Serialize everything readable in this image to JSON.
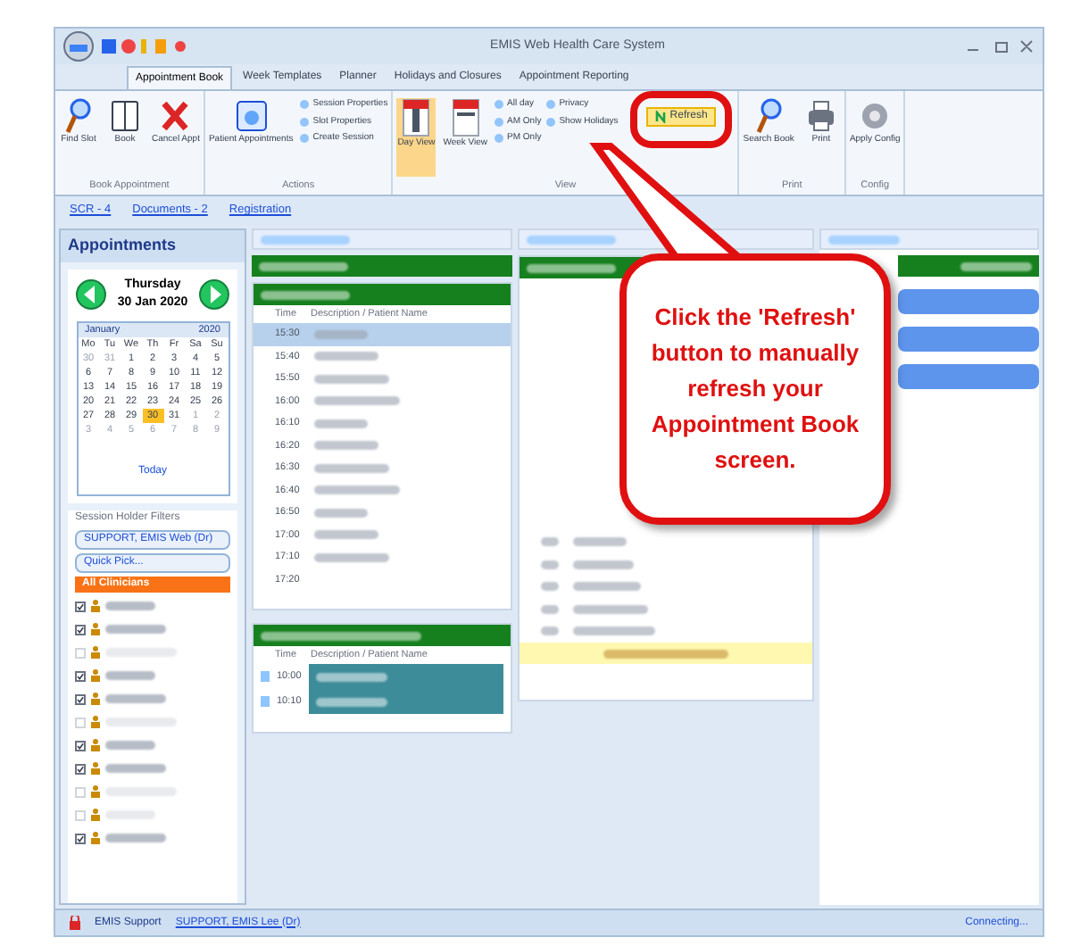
{
  "window": {
    "title": "EMIS Web Health Care System"
  },
  "tabs": [
    {
      "label": "Appointment Book",
      "selected": true
    },
    {
      "label": "Week Templates",
      "selected": false
    },
    {
      "label": "Planner",
      "selected": false
    },
    {
      "label": "Holidays and Closures",
      "selected": false
    },
    {
      "label": "Appointment Reporting",
      "selected": false
    }
  ],
  "ribbon_groups": [
    {
      "label": "Book Appointment",
      "buttons": [
        {
          "label": "Find Slot",
          "kind": "search"
        },
        {
          "label": "Book",
          "kind": "book"
        },
        {
          "label": "Cancel Appt",
          "kind": "cancel"
        }
      ]
    },
    {
      "label": "Actions",
      "buttons": [
        {
          "label": "Patient Appointments",
          "kind": "patient"
        }
      ],
      "small": [
        "Session Properties",
        "Slot Properties",
        "Create Session"
      ]
    },
    {
      "label": "View",
      "buttons": [
        {
          "label": "Day View",
          "kind": "day",
          "selected": true
        },
        {
          "label": "Week View",
          "kind": "week",
          "selected": false
        }
      ],
      "small": [
        "All day",
        "AM Only",
        "PM Only",
        "Privacy",
        "Show Holidays"
      ],
      "refresh": "Refresh"
    },
    {
      "label": "Print",
      "buttons": [
        {
          "label": "Search Book",
          "kind": "search"
        },
        {
          "label": "Print",
          "kind": "print"
        }
      ]
    },
    {
      "label": "Config",
      "buttons": [
        {
          "label": "Apply Config",
          "kind": "config"
        }
      ]
    }
  ],
  "links": [
    "SCR - 4",
    "Documents - 2",
    "Registration"
  ],
  "sidebar": {
    "title": "Appointments",
    "day": "Thursday",
    "date": "30 Jan 2020",
    "month": "January",
    "year": "2020",
    "weekdays": [
      "Mo",
      "Tu",
      "We",
      "Th",
      "Fr",
      "Sa",
      "Su"
    ],
    "days": [
      {
        "d": "30",
        "other": true,
        "selected": false
      },
      {
        "d": "31",
        "other": true,
        "selected": false
      },
      {
        "d": "1",
        "other": false,
        "selected": false
      },
      {
        "d": "2",
        "other": false,
        "selected": false
      },
      {
        "d": "3",
        "other": false,
        "selected": false
      },
      {
        "d": "4",
        "other": false,
        "selected": false
      },
      {
        "d": "5",
        "other": false,
        "selected": false
      },
      {
        "d": "6",
        "other": false,
        "selected": false
      },
      {
        "d": "7",
        "other": false,
        "selected": false
      },
      {
        "d": "8",
        "other": false,
        "selected": false
      },
      {
        "d": "9",
        "other": false,
        "selected": false
      },
      {
        "d": "10",
        "other": false,
        "selected": false
      },
      {
        "d": "11",
        "other": false,
        "selected": false
      },
      {
        "d": "12",
        "other": false,
        "selected": false
      },
      {
        "d": "13",
        "other": false,
        "selected": false
      },
      {
        "d": "14",
        "other": false,
        "selected": false
      },
      {
        "d": "15",
        "other": false,
        "selected": false
      },
      {
        "d": "16",
        "other": false,
        "selected": false
      },
      {
        "d": "17",
        "other": false,
        "selected": false
      },
      {
        "d": "18",
        "other": false,
        "selected": false
      },
      {
        "d": "19",
        "other": false,
        "selected": false
      },
      {
        "d": "20",
        "other": false,
        "selected": false
      },
      {
        "d": "21",
        "other": false,
        "selected": false
      },
      {
        "d": "22",
        "other": false,
        "selected": false
      },
      {
        "d": "23",
        "other": false,
        "selected": false
      },
      {
        "d": "24",
        "other": false,
        "selected": false
      },
      {
        "d": "25",
        "other": false,
        "selected": false
      },
      {
        "d": "26",
        "other": false,
        "selected": false
      },
      {
        "d": "27",
        "other": false,
        "selected": false
      },
      {
        "d": "28",
        "other": false,
        "selected": false
      },
      {
        "d": "29",
        "other": false,
        "selected": false
      },
      {
        "d": "30",
        "other": false,
        "selected": true
      },
      {
        "d": "31",
        "other": false,
        "selected": false
      },
      {
        "d": "1",
        "other": true,
        "selected": false
      },
      {
        "d": "2",
        "other": true,
        "selected": false
      },
      {
        "d": "3",
        "other": true,
        "selected": false
      },
      {
        "d": "4",
        "other": true,
        "selected": false
      },
      {
        "d": "5",
        "other": true,
        "selected": false
      },
      {
        "d": "6",
        "other": true,
        "selected": false
      },
      {
        "d": "7",
        "other": true,
        "selected": false
      },
      {
        "d": "8",
        "other": true,
        "selected": false
      },
      {
        "d": "9",
        "other": true,
        "selected": false
      }
    ],
    "today": "Today",
    "filters_title": "Session Holder Filters",
    "holder": "SUPPORT, EMIS Web (Dr)",
    "quick_pick": "Quick Pick...",
    "all_clinicians": "All Clinicians",
    "clinicians": [
      {
        "checked": true
      },
      {
        "checked": true
      },
      {
        "checked": false
      },
      {
        "checked": true
      },
      {
        "checked": true
      },
      {
        "checked": false
      },
      {
        "checked": true
      },
      {
        "checked": true
      },
      {
        "checked": false
      },
      {
        "checked": false
      },
      {
        "checked": true
      }
    ]
  },
  "column_1": {
    "headers": [
      "Time",
      "Description / Patient Name"
    ],
    "rows": [
      {
        "time": "15:30",
        "selected": true
      },
      {
        "time": "15:40",
        "selected": false
      },
      {
        "time": "15:50",
        "selected": false
      },
      {
        "time": "16:00",
        "selected": false
      },
      {
        "time": "16:10",
        "selected": false
      },
      {
        "time": "16:20",
        "selected": false
      },
      {
        "time": "16:30",
        "selected": false
      },
      {
        "time": "16:40",
        "selected": false
      },
      {
        "time": "16:50",
        "selected": false
      },
      {
        "time": "17:00",
        "selected": false
      },
      {
        "time": "17:10",
        "selected": false
      },
      {
        "time": "17:20",
        "selected": false
      }
    ],
    "second_headers": [
      "Time",
      "Description / Patient Name"
    ],
    "second_rows": [
      {
        "time": "10:00"
      },
      {
        "time": "10:10"
      }
    ]
  },
  "callout": {
    "text": "Click the 'Refresh' button to manually refresh your Appointment Book screen."
  },
  "status_bar": {
    "user": "EMIS Support",
    "holder": "SUPPORT, EMIS Lee (Dr)",
    "state": "Connecting..."
  }
}
